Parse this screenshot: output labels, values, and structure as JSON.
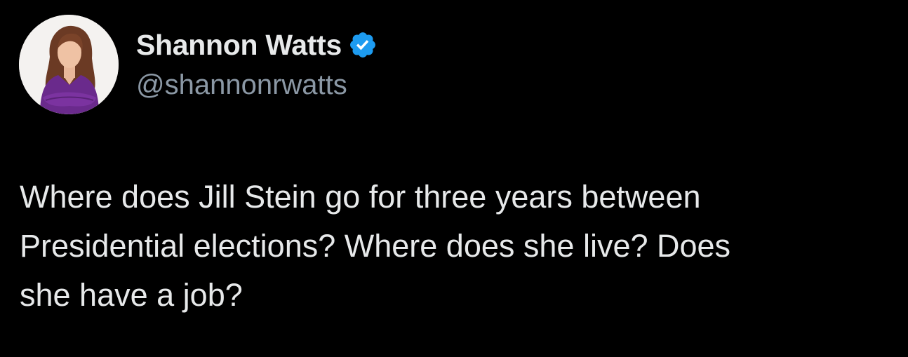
{
  "tweet": {
    "author": {
      "display_name": "Shannon Watts",
      "handle": "@shannonrwatts",
      "verified": true,
      "avatar_icon": "profile-photo",
      "verified_icon": "verified-badge-icon"
    },
    "text": "Where does Jill Stein go for three years between\nPresidential elections? Where does she live? Does\nshe have a job?"
  },
  "colors": {
    "background": "#000000",
    "text_primary": "#e7e9ea",
    "text_secondary": "#8b98a5",
    "verified_blue": "#1d9bf0"
  }
}
